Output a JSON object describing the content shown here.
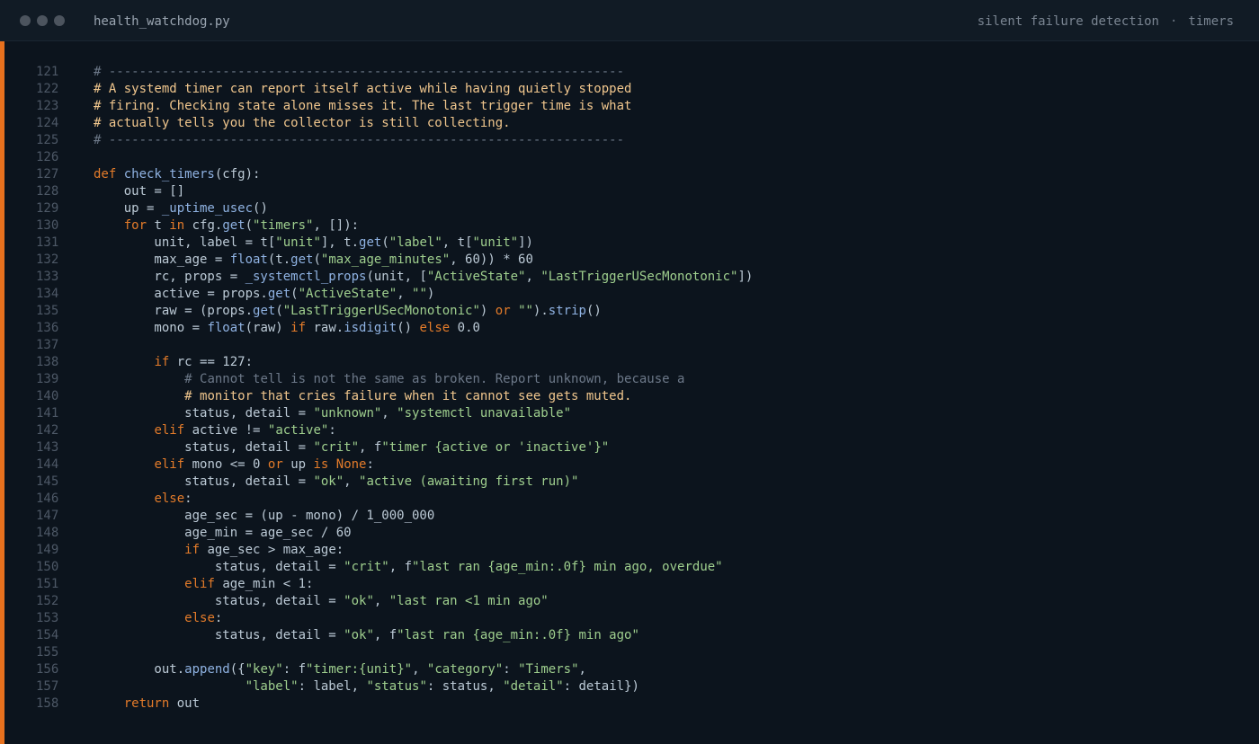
{
  "window": {
    "filename": "health_watchdog.py",
    "tags": [
      "silent failure detection",
      "timers"
    ],
    "tag_separator": "·"
  },
  "colors": {
    "accent": "#e8711e",
    "keyword": "#e37b2a",
    "function": "#8fb2e2",
    "string": "#9fcf8e",
    "comment": "#6c7888",
    "comment_highlight": "#f0c68d",
    "text": "#bccad6"
  },
  "editor": {
    "lines": [
      {
        "n": "121",
        "tokens": [
          [
            "cm",
            "# --------------------------------------------------------------------"
          ]
        ]
      },
      {
        "n": "122",
        "tokens": [
          [
            "cmh",
            "# A systemd timer can report itself active while having quietly stopped"
          ]
        ]
      },
      {
        "n": "123",
        "tokens": [
          [
            "cmh",
            "# firing. Checking state alone misses it. The last trigger time is what"
          ]
        ]
      },
      {
        "n": "124",
        "tokens": [
          [
            "cmh",
            "# actually tells you the collector is still collecting."
          ]
        ]
      },
      {
        "n": "125",
        "tokens": [
          [
            "cm",
            "# --------------------------------------------------------------------"
          ]
        ]
      },
      {
        "n": "126",
        "tokens": []
      },
      {
        "n": "127",
        "tokens": [
          [
            "kw",
            "def "
          ],
          [
            "fn",
            "check_timers"
          ],
          [
            "tx",
            "(cfg):"
          ]
        ]
      },
      {
        "n": "128",
        "tokens": [
          [
            "tx",
            "    out = []"
          ]
        ]
      },
      {
        "n": "129",
        "tokens": [
          [
            "tx",
            "    up = "
          ],
          [
            "fn",
            "_uptime_usec"
          ],
          [
            "tx",
            "()"
          ]
        ]
      },
      {
        "n": "130",
        "tokens": [
          [
            "tx",
            "    "
          ],
          [
            "kw",
            "for "
          ],
          [
            "tx",
            "t "
          ],
          [
            "kw",
            "in "
          ],
          [
            "tx",
            "cfg."
          ],
          [
            "fn",
            "get"
          ],
          [
            "tx",
            "("
          ],
          [
            "str",
            "\"timers\""
          ],
          [
            "tx",
            ", []):"
          ]
        ]
      },
      {
        "n": "131",
        "tokens": [
          [
            "tx",
            "        unit, label = t["
          ],
          [
            "str",
            "\"unit\""
          ],
          [
            "tx",
            "], t."
          ],
          [
            "fn",
            "get"
          ],
          [
            "tx",
            "("
          ],
          [
            "str",
            "\"label\""
          ],
          [
            "tx",
            ", t["
          ],
          [
            "str",
            "\"unit\""
          ],
          [
            "tx",
            "])"
          ]
        ]
      },
      {
        "n": "132",
        "tokens": [
          [
            "tx",
            "        max_age = "
          ],
          [
            "fn",
            "float"
          ],
          [
            "tx",
            "(t."
          ],
          [
            "fn",
            "get"
          ],
          [
            "tx",
            "("
          ],
          [
            "str",
            "\"max_age_minutes\""
          ],
          [
            "tx",
            ", 60)) * 60"
          ]
        ]
      },
      {
        "n": "133",
        "tokens": [
          [
            "tx",
            "        rc, props = "
          ],
          [
            "fn",
            "_systemctl_props"
          ],
          [
            "tx",
            "(unit, ["
          ],
          [
            "str",
            "\"ActiveState\""
          ],
          [
            "tx",
            ", "
          ],
          [
            "str",
            "\"LastTriggerUSecMonotonic\""
          ],
          [
            "tx",
            "])"
          ]
        ]
      },
      {
        "n": "134",
        "tokens": [
          [
            "tx",
            "        active = props."
          ],
          [
            "fn",
            "get"
          ],
          [
            "tx",
            "("
          ],
          [
            "str",
            "\"ActiveState\""
          ],
          [
            "tx",
            ", "
          ],
          [
            "str",
            "\"\""
          ],
          [
            "tx",
            ")"
          ]
        ]
      },
      {
        "n": "135",
        "tokens": [
          [
            "tx",
            "        raw = (props."
          ],
          [
            "fn",
            "get"
          ],
          [
            "tx",
            "("
          ],
          [
            "str",
            "\"LastTriggerUSecMonotonic\""
          ],
          [
            "tx",
            ") "
          ],
          [
            "kw",
            "or "
          ],
          [
            "str",
            "\"\""
          ],
          [
            "tx",
            ")."
          ],
          [
            "fn",
            "strip"
          ],
          [
            "tx",
            "()"
          ]
        ]
      },
      {
        "n": "136",
        "tokens": [
          [
            "tx",
            "        mono = "
          ],
          [
            "fn",
            "float"
          ],
          [
            "tx",
            "(raw) "
          ],
          [
            "kw",
            "if "
          ],
          [
            "tx",
            "raw."
          ],
          [
            "fn",
            "isdigit"
          ],
          [
            "tx",
            "() "
          ],
          [
            "kw",
            "else "
          ],
          [
            "tx",
            "0.0"
          ]
        ]
      },
      {
        "n": "137",
        "tokens": []
      },
      {
        "n": "138",
        "tokens": [
          [
            "tx",
            "        "
          ],
          [
            "kw",
            "if "
          ],
          [
            "tx",
            "rc == 127:"
          ]
        ]
      },
      {
        "n": "139",
        "tokens": [
          [
            "tx",
            "            "
          ],
          [
            "cm",
            "# Cannot tell is not the same as broken. Report unknown, because a"
          ]
        ]
      },
      {
        "n": "140",
        "tokens": [
          [
            "tx",
            "            "
          ],
          [
            "cmh",
            "# monitor that cries failure when it cannot see gets muted."
          ]
        ]
      },
      {
        "n": "141",
        "tokens": [
          [
            "tx",
            "            status, detail = "
          ],
          [
            "str",
            "\"unknown\""
          ],
          [
            "tx",
            ", "
          ],
          [
            "str",
            "\"systemctl unavailable\""
          ]
        ]
      },
      {
        "n": "142",
        "tokens": [
          [
            "tx",
            "        "
          ],
          [
            "kw",
            "elif "
          ],
          [
            "tx",
            "active != "
          ],
          [
            "str",
            "\"active\""
          ],
          [
            "tx",
            ":"
          ]
        ]
      },
      {
        "n": "143",
        "tokens": [
          [
            "tx",
            "            status, detail = "
          ],
          [
            "str",
            "\"crit\""
          ],
          [
            "tx",
            ", f"
          ],
          [
            "str",
            "\"timer {active or 'inactive'}\""
          ]
        ]
      },
      {
        "n": "144",
        "tokens": [
          [
            "tx",
            "        "
          ],
          [
            "kw",
            "elif "
          ],
          [
            "tx",
            "mono <= 0 "
          ],
          [
            "kw",
            "or "
          ],
          [
            "tx",
            "up "
          ],
          [
            "kw",
            "is None"
          ],
          [
            "tx",
            ":"
          ]
        ]
      },
      {
        "n": "145",
        "tokens": [
          [
            "tx",
            "            status, detail = "
          ],
          [
            "str",
            "\"ok\""
          ],
          [
            "tx",
            ", "
          ],
          [
            "str",
            "\"active (awaiting first run)\""
          ]
        ]
      },
      {
        "n": "146",
        "tokens": [
          [
            "tx",
            "        "
          ],
          [
            "kw",
            "else"
          ],
          [
            "tx",
            ":"
          ]
        ]
      },
      {
        "n": "147",
        "tokens": [
          [
            "tx",
            "            age_sec = (up - mono) / 1_000_000"
          ]
        ]
      },
      {
        "n": "148",
        "tokens": [
          [
            "tx",
            "            age_min = age_sec / 60"
          ]
        ]
      },
      {
        "n": "149",
        "tokens": [
          [
            "tx",
            "            "
          ],
          [
            "kw",
            "if "
          ],
          [
            "tx",
            "age_sec > max_age:"
          ]
        ]
      },
      {
        "n": "150",
        "tokens": [
          [
            "tx",
            "                status, detail = "
          ],
          [
            "str",
            "\"crit\""
          ],
          [
            "tx",
            ", f"
          ],
          [
            "str",
            "\"last ran {age_min:.0f} min ago, overdue\""
          ]
        ]
      },
      {
        "n": "151",
        "tokens": [
          [
            "tx",
            "            "
          ],
          [
            "kw",
            "elif "
          ],
          [
            "tx",
            "age_min < 1:"
          ]
        ]
      },
      {
        "n": "152",
        "tokens": [
          [
            "tx",
            "                status, detail = "
          ],
          [
            "str",
            "\"ok\""
          ],
          [
            "tx",
            ", "
          ],
          [
            "str",
            "\"last ran <1 min ago\""
          ]
        ]
      },
      {
        "n": "153",
        "tokens": [
          [
            "tx",
            "            "
          ],
          [
            "kw",
            "else"
          ],
          [
            "tx",
            ":"
          ]
        ]
      },
      {
        "n": "154",
        "tokens": [
          [
            "tx",
            "                status, detail = "
          ],
          [
            "str",
            "\"ok\""
          ],
          [
            "tx",
            ", f"
          ],
          [
            "str",
            "\"last ran {age_min:.0f} min ago\""
          ]
        ]
      },
      {
        "n": "155",
        "tokens": []
      },
      {
        "n": "156",
        "tokens": [
          [
            "tx",
            "        out."
          ],
          [
            "fn",
            "append"
          ],
          [
            "tx",
            "({"
          ],
          [
            "str",
            "\"key\""
          ],
          [
            "tx",
            ": f"
          ],
          [
            "str",
            "\"timer:{unit}\""
          ],
          [
            "tx",
            ", "
          ],
          [
            "str",
            "\"category\""
          ],
          [
            "tx",
            ": "
          ],
          [
            "str",
            "\"Timers\""
          ],
          [
            "tx",
            ","
          ]
        ]
      },
      {
        "n": "157",
        "tokens": [
          [
            "tx",
            "                    "
          ],
          [
            "str",
            "\"label\""
          ],
          [
            "tx",
            ": label, "
          ],
          [
            "str",
            "\"status\""
          ],
          [
            "tx",
            ": status, "
          ],
          [
            "str",
            "\"detail\""
          ],
          [
            "tx",
            ": detail})"
          ]
        ]
      },
      {
        "n": "158",
        "tokens": [
          [
            "tx",
            "    "
          ],
          [
            "kw",
            "return "
          ],
          [
            "tx",
            "out"
          ]
        ]
      }
    ]
  }
}
